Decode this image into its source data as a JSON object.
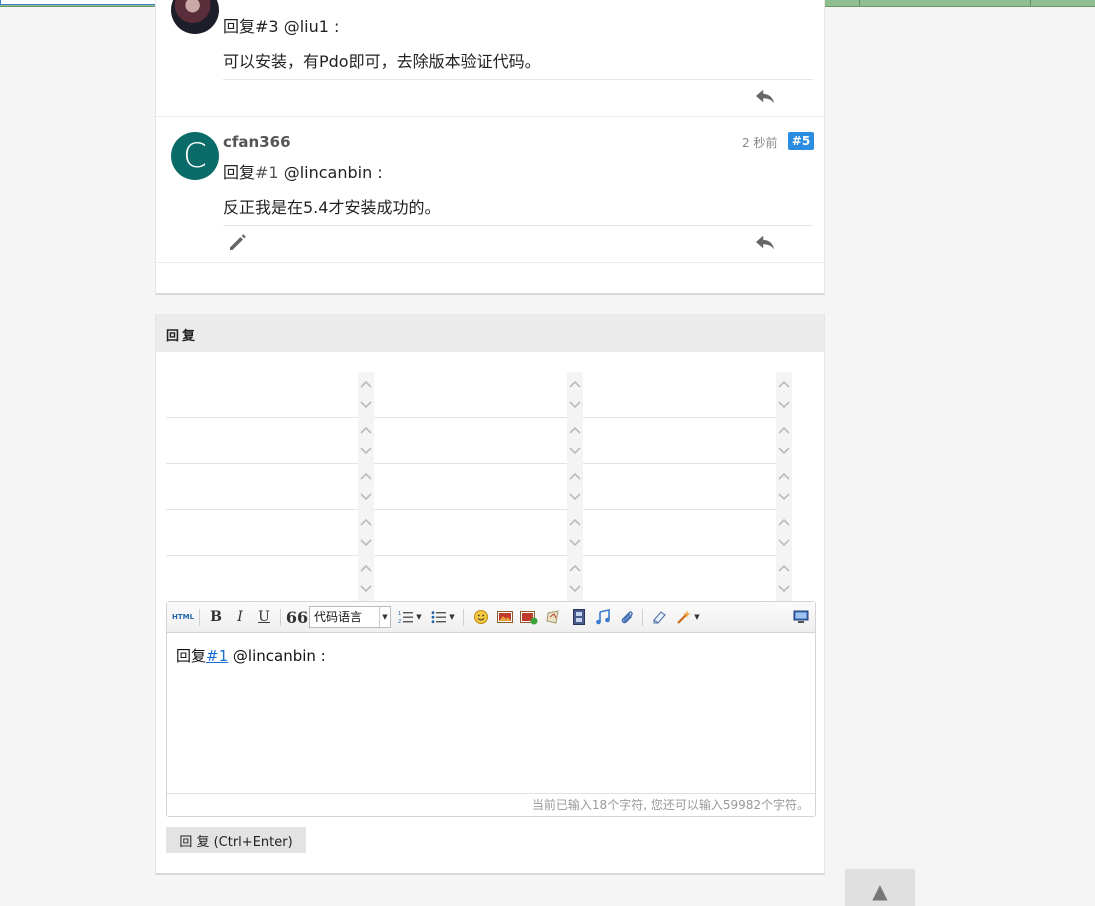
{
  "posts": [
    {
      "reply_prefix": "回复",
      "reply_ref": "#3",
      "reply_to": " @liu1 :",
      "content": "可以安装，有Pdo即可，去除版本验证代码。"
    },
    {
      "avatar_letter": "C",
      "username": "cfan366",
      "time": "2 秒前",
      "floor": "#5",
      "reply_prefix": "回复",
      "reply_ref": "#1",
      "reply_to": " @lincanbin :",
      "content": "反正我是在5.4才安装成功的。"
    }
  ],
  "reply_form": {
    "title": "回复",
    "toolbar": {
      "html_label": "HTML",
      "bold": "B",
      "italic": "I",
      "underline": "U",
      "quote": "66",
      "code_language": "代码语言"
    },
    "editor": {
      "prefix": "回复",
      "ref": "#1",
      "mention": " @lincanbin :"
    },
    "char_count": "当前已输入18个字符, 您还可以输入59982个字符。",
    "submit_label": "回 复 (Ctrl+Enter)"
  },
  "back_to_top": "▲",
  "icons": [
    "reply-icon",
    "edit-icon",
    "html-icon",
    "ordered-list-icon",
    "unordered-list-icon",
    "emoticon-icon",
    "image-icon",
    "upload-image-icon",
    "flash-icon",
    "video-icon",
    "music-icon",
    "attachment-icon",
    "eraser-icon",
    "magic-icon",
    "fullscreen-icon"
  ]
}
